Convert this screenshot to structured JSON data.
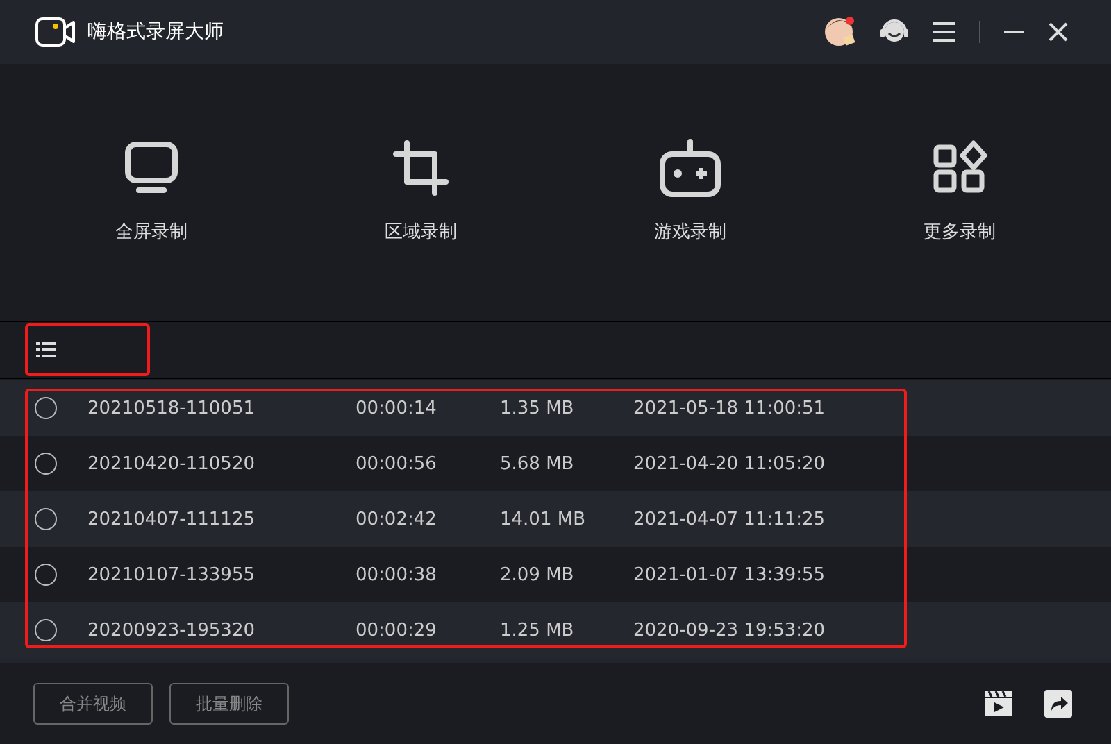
{
  "window": {
    "title": "嗨格式录屏大师"
  },
  "modes": [
    {
      "label": "全屏录制",
      "kind": "screen"
    },
    {
      "label": "区域录制",
      "kind": "crop"
    },
    {
      "label": "游戏录制",
      "kind": "game"
    },
    {
      "label": "更多录制",
      "kind": "more"
    }
  ],
  "recordings": [
    {
      "name": "20210518-110051",
      "duration": "00:00:14",
      "size": "1.35 MB",
      "date": "2021-05-18 11:00:51",
      "selected": false
    },
    {
      "name": "20210420-110520",
      "duration": "00:00:56",
      "size": "5.68 MB",
      "date": "2021-04-20 11:05:20",
      "selected": false
    },
    {
      "name": "20210407-111125",
      "duration": "00:02:42",
      "size": "14.01 MB",
      "date": "2021-04-07 11:11:25",
      "selected": false
    },
    {
      "name": "20210107-133955",
      "duration": "00:00:38",
      "size": "2.09 MB",
      "date": "2021-01-07 13:39:55",
      "selected": false
    },
    {
      "name": "20200923-195320",
      "duration": "00:00:29",
      "size": "1.25 MB",
      "date": "2020-09-23 19:53:20",
      "selected": false
    }
  ],
  "buttons": [
    "合并视频",
    "批量删除"
  ]
}
